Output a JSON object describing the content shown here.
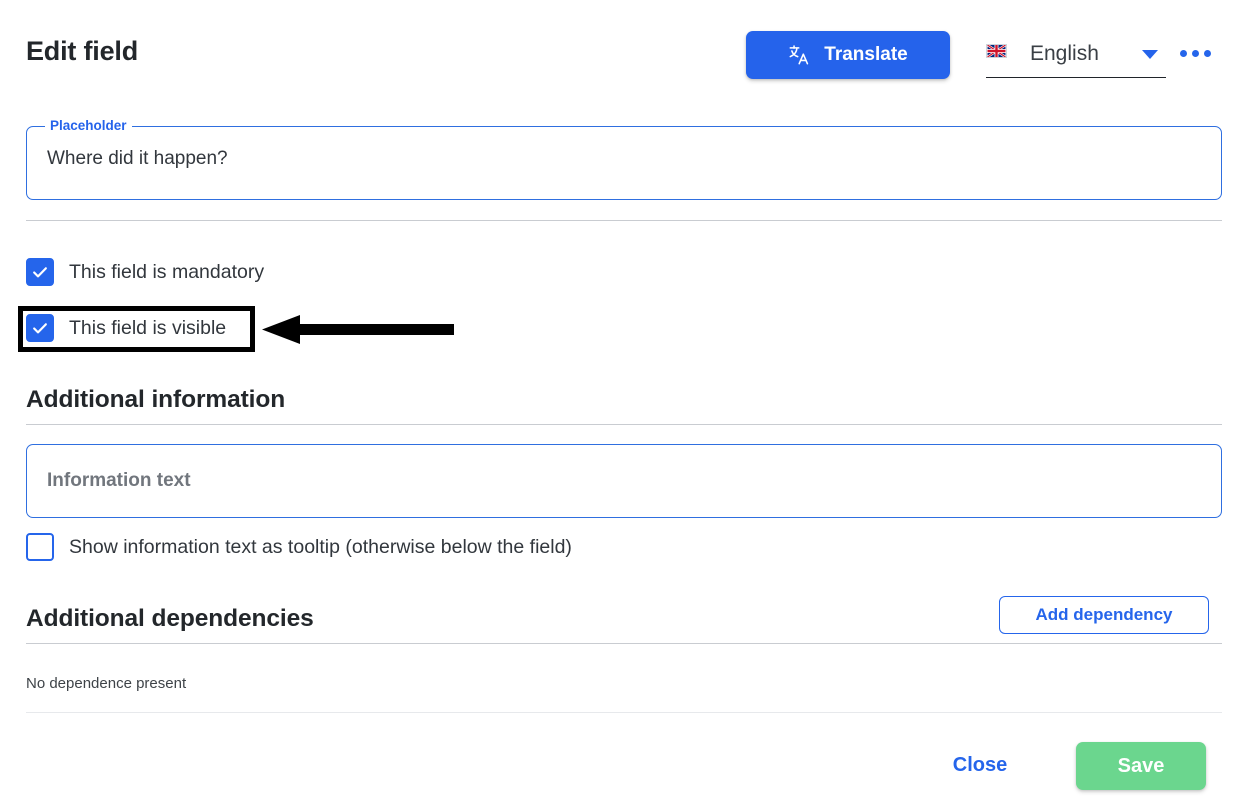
{
  "header": {
    "title": "Edit field",
    "translate_button": {
      "label": "Translate",
      "icon": "translate-icon",
      "color": "#2563eb"
    },
    "language_select": {
      "value": "English",
      "flag": "uk-flag-icon",
      "caret": "chevron-down-icon"
    },
    "more_menu": {
      "icon": "more-horizontal-icon"
    }
  },
  "placeholder_field": {
    "legend": "Placeholder",
    "value": "Where did it happen?"
  },
  "options": {
    "mandatory": {
      "label": "This field is mandatory",
      "checked": true
    },
    "visible": {
      "label": "This field is visible",
      "checked": true,
      "annotated": true
    }
  },
  "additional_information": {
    "heading": "Additional information",
    "info_text": {
      "value": "",
      "placeholder": "Information text"
    },
    "tooltip_option": {
      "label": "Show information text as tooltip (otherwise below the field)",
      "checked": false
    }
  },
  "additional_dependencies": {
    "heading": "Additional dependencies",
    "add_button_label": "Add dependency",
    "empty_state": "No dependence present"
  },
  "footer": {
    "close_label": "Close",
    "save_label": "Save",
    "save_color": "#6bd68e"
  },
  "colors": {
    "accent_blue": "#2565eb",
    "save_green": "#6bd68e",
    "text_dark": "#23272b",
    "annotation": "#000000"
  }
}
